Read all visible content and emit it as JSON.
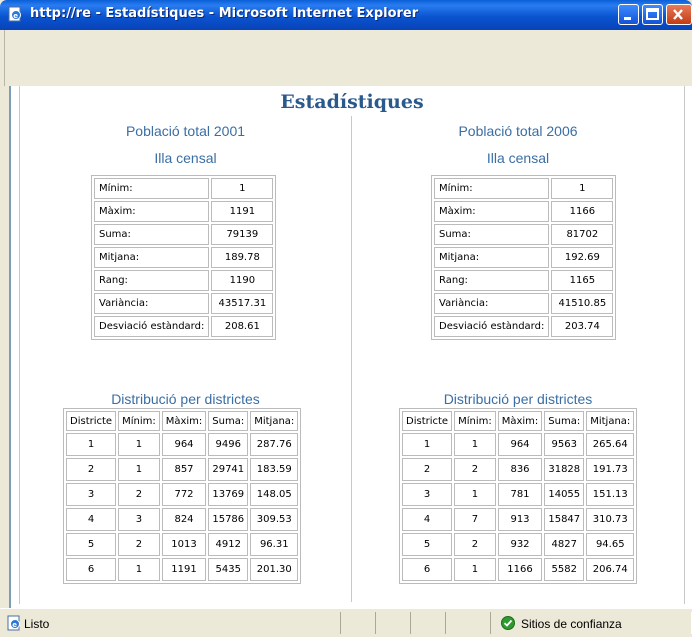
{
  "window": {
    "title": "http://re - Estadístiques - Microsoft Internet Explorer"
  },
  "page": {
    "heading": "Estadístiques"
  },
  "left": {
    "title": "Població total 2001",
    "subtitle": "Illa censal",
    "stats": [
      {
        "label": "Mínim:",
        "value": "1"
      },
      {
        "label": "Màxim:",
        "value": "1191"
      },
      {
        "label": "Suma:",
        "value": "79139"
      },
      {
        "label": "Mitjana:",
        "value": "189.78"
      },
      {
        "label": "Rang:",
        "value": "1190"
      },
      {
        "label": "Variància:",
        "value": "43517.31"
      },
      {
        "label": "Desviació estàndard:",
        "value": "208.61"
      }
    ],
    "dist_title": "Distribució per districtes",
    "dist_headers": [
      "Districte",
      "Mínim:",
      "Màxim:",
      "Suma:",
      "Mitjana:"
    ],
    "dist_rows": [
      [
        "1",
        "1",
        "964",
        "9496",
        "287.76"
      ],
      [
        "2",
        "1",
        "857",
        "29741",
        "183.59"
      ],
      [
        "3",
        "2",
        "772",
        "13769",
        "148.05"
      ],
      [
        "4",
        "3",
        "824",
        "15786",
        "309.53"
      ],
      [
        "5",
        "2",
        "1013",
        "4912",
        "96.31"
      ],
      [
        "6",
        "1",
        "1191",
        "5435",
        "201.30"
      ]
    ]
  },
  "right": {
    "title": "Població total 2006",
    "subtitle": "Illa censal",
    "stats": [
      {
        "label": "Mínim:",
        "value": "1"
      },
      {
        "label": "Màxim:",
        "value": "1166"
      },
      {
        "label": "Suma:",
        "value": "81702"
      },
      {
        "label": "Mitjana:",
        "value": "192.69"
      },
      {
        "label": "Rang:",
        "value": "1165"
      },
      {
        "label": "Variància:",
        "value": "41510.85"
      },
      {
        "label": "Desviació estàndard:",
        "value": "203.74"
      }
    ],
    "dist_title": "Distribució per districtes",
    "dist_headers": [
      "Districte",
      "Mínim:",
      "Màxim:",
      "Suma:",
      "Mitjana:"
    ],
    "dist_rows": [
      [
        "1",
        "1",
        "964",
        "9563",
        "265.64"
      ],
      [
        "2",
        "2",
        "836",
        "31828",
        "191.73"
      ],
      [
        "3",
        "1",
        "781",
        "14055",
        "151.13"
      ],
      [
        "4",
        "7",
        "913",
        "15847",
        "310.73"
      ],
      [
        "5",
        "2",
        "932",
        "4827",
        "94.65"
      ],
      [
        "6",
        "1",
        "1166",
        "5582",
        "206.74"
      ]
    ]
  },
  "statusbar": {
    "text": "Listo",
    "zone": "Sitios de confianza",
    "zone_icon": "check-shield-icon",
    "page_icon": "ie-page-icon"
  }
}
